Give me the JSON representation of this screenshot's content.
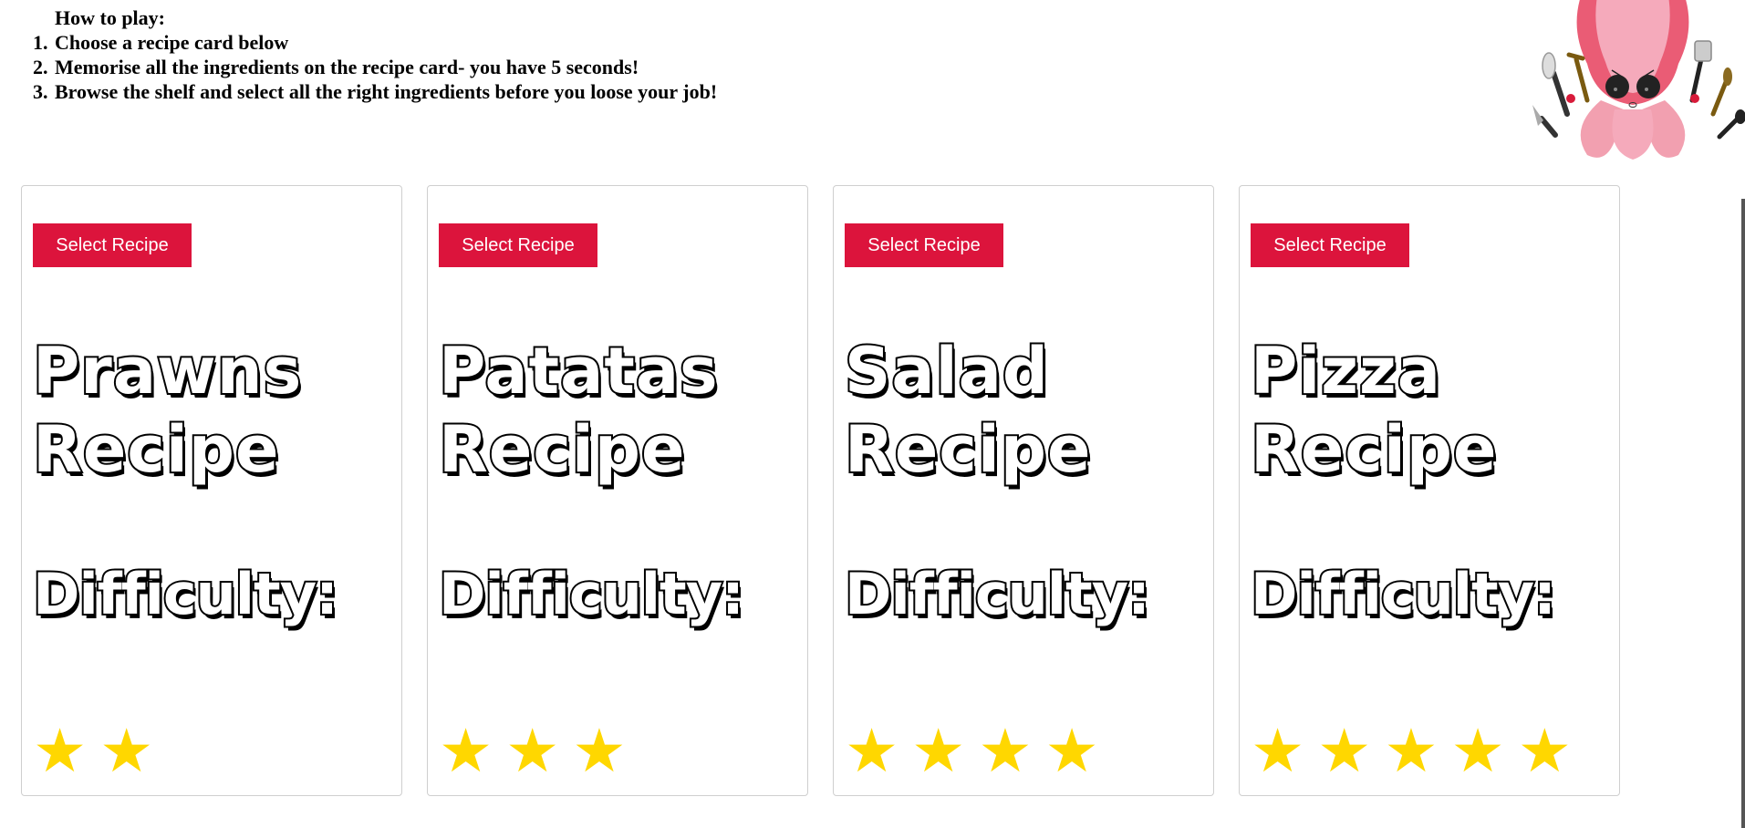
{
  "instructions": {
    "heading": "How to play:",
    "steps": [
      {
        "num": "1.",
        "text": "Choose a recipe card below"
      },
      {
        "num": "2.",
        "text": "Memorise all the ingredients on the recipe card- you have 5 seconds!"
      },
      {
        "num": "3.",
        "text": "Browse the shelf and select all the right ingredients before you loose your job!"
      }
    ]
  },
  "mascot": {
    "icon": "octopus-chef-icon"
  },
  "colors": {
    "button": "#dc143c",
    "star": "#ffd700"
  },
  "cards": [
    {
      "button_label": "Select Recipe",
      "title": "Prawns Recipe",
      "difficulty_label": "Difficulty:",
      "stars": 2,
      "star_glyph": "★"
    },
    {
      "button_label": "Select Recipe",
      "title": "Patatas Recipe",
      "difficulty_label": "Difficulty:",
      "stars": 3,
      "star_glyph": "★"
    },
    {
      "button_label": "Select Recipe",
      "title": "Salad Recipe",
      "difficulty_label": "Difficulty:",
      "stars": 4,
      "star_glyph": "★"
    },
    {
      "button_label": "Select Recipe",
      "title": "Pizza Recipe",
      "difficulty_label": "Difficulty:",
      "stars": 5,
      "star_glyph": "★"
    }
  ]
}
